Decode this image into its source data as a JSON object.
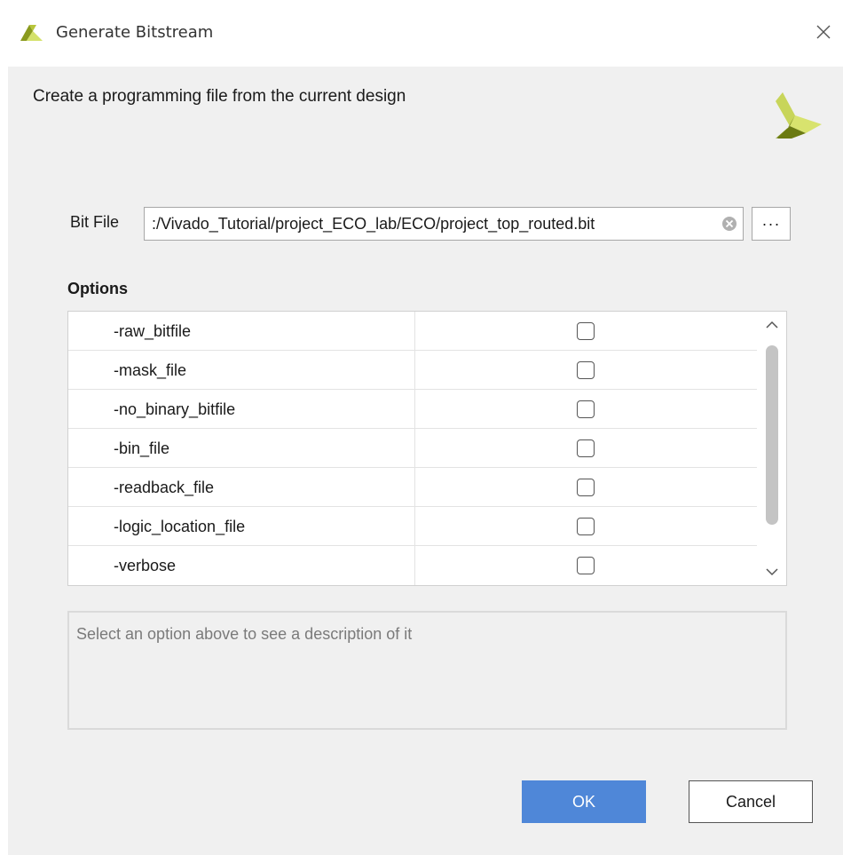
{
  "window": {
    "title": "Generate Bitstream",
    "logo_icon": "xilinx-logo-icon",
    "close_icon": "close-icon"
  },
  "header": {
    "description": "Create a programming file from the current design",
    "brand_icon": "xilinx-logo-icon"
  },
  "bit_file": {
    "label": "Bit File",
    "value": ":/Vivado_Tutorial/project_ECO_lab/ECO/project_top_routed.bit",
    "clear_icon": "clear-icon",
    "browse_label": "···"
  },
  "options": {
    "label": "Options",
    "rows": [
      {
        "name": "-raw_bitfile",
        "checked": false
      },
      {
        "name": "-mask_file",
        "checked": false
      },
      {
        "name": "-no_binary_bitfile",
        "checked": false
      },
      {
        "name": "-bin_file",
        "checked": false
      },
      {
        "name": "-readback_file",
        "checked": false
      },
      {
        "name": "-logic_location_file",
        "checked": false
      },
      {
        "name": "-verbose",
        "checked": false
      }
    ]
  },
  "description_box": {
    "placeholder": "Select an option above to see a description of it"
  },
  "buttons": {
    "ok": "OK",
    "cancel": "Cancel"
  },
  "colors": {
    "accent": "#4f87d8",
    "logo_dark": "#7a8a1a",
    "logo_light": "#d4e16a"
  }
}
